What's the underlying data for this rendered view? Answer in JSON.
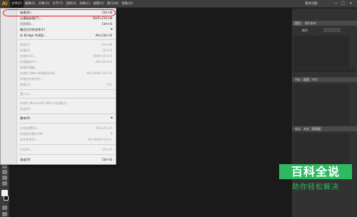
{
  "app": {
    "logo": "Ai"
  },
  "menubar": {
    "items": [
      "文件(F)",
      "编辑(E)",
      "对象(O)",
      "文字(T)",
      "选择(S)",
      "效果(C)",
      "视图(V)",
      "窗口(W)",
      "帮助(H)"
    ],
    "workspace": "基本功能",
    "window_controls": [
      "—",
      "□",
      "✕"
    ]
  },
  "file_menu": {
    "items": [
      {
        "label": "新建(N)...",
        "shortcut": "Ctrl+N"
      },
      {
        "label": "从模板新建(T)...",
        "shortcut": "Shift+Ctrl+N"
      },
      {
        "label": "打开(O)...",
        "shortcut": "Ctrl+O"
      },
      {
        "label": "最近打开的文件(F)",
        "shortcut": "▸"
      },
      {
        "label": "在 Bridge 中浏览...",
        "shortcut": "Alt+Ctrl+O"
      },
      {
        "label": "关闭(C)",
        "shortcut": "Ctrl+W"
      },
      {
        "label": "存储(S)",
        "shortcut": "Ctrl+S"
      },
      {
        "label": "存储为(A)...",
        "shortcut": "Shift+Ctrl+S"
      },
      {
        "label": "存储副本(Y)...",
        "shortcut": "Alt+Ctrl+S"
      },
      {
        "label": "存储为模板...",
        "shortcut": ""
      },
      {
        "label": "存储为 Web 所用格式(W)...",
        "shortcut": "Alt+Shift+Ctrl+S"
      },
      {
        "label": "存储选中的切片...",
        "shortcut": ""
      },
      {
        "label": "恢复(V)",
        "shortcut": "F12"
      },
      {
        "label": "置入(L)...",
        "shortcut": ""
      },
      {
        "label": "存储为 Microsoft Office 所用格式...",
        "shortcut": ""
      },
      {
        "label": "导出(E)...",
        "shortcut": ""
      },
      {
        "label": "脚本(R)",
        "shortcut": "▸"
      },
      {
        "label": "文档设置(D)...",
        "shortcut": "Alt+Ctrl+P"
      },
      {
        "label": "文档颜色模式(M)",
        "shortcut": "▸"
      },
      {
        "label": "文件信息(I)...",
        "shortcut": "Alt+Shift+Ctrl+I"
      },
      {
        "label": "打印(P)...",
        "shortcut": "Ctrl+P"
      },
      {
        "label": "退出(X)",
        "shortcut": "Ctrl+Q"
      }
    ]
  },
  "panels": {
    "top_tabs": [
      "颜色",
      "颜色参考"
    ],
    "color_row": "颜色",
    "mid_tabs": [
      "色板",
      "画笔",
      "符号"
    ],
    "bottom_tabs": [
      "描边",
      "渐变",
      "透明度"
    ]
  },
  "watermark": {
    "title": "百科全说",
    "subtitle": "助你轻松解决"
  },
  "colors": {
    "highlight": "#e8162d",
    "brand": "#2dbb62"
  }
}
